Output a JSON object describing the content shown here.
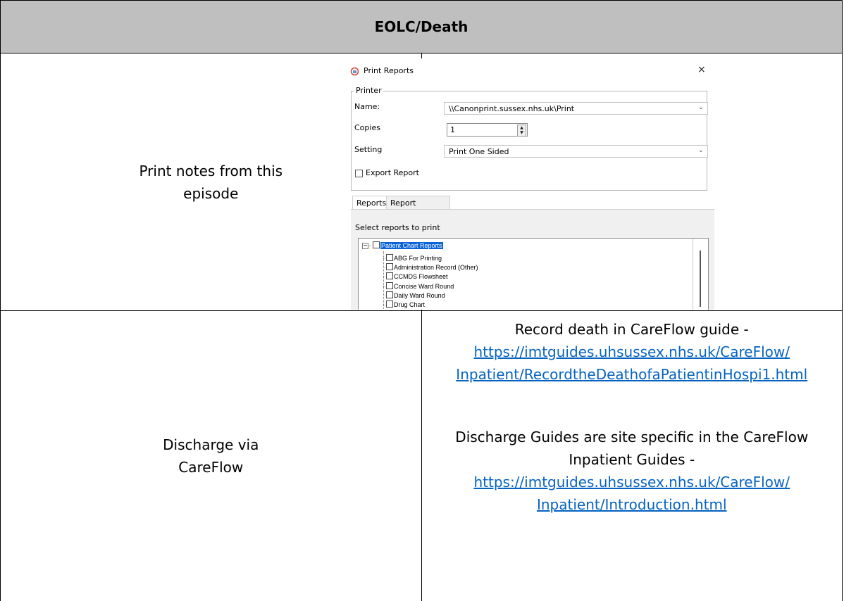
{
  "table": {
    "header": "EOLC/Death",
    "row1_label": "Print notes from this episode",
    "row2_label": "Discharge via CareFlow"
  },
  "row2": {
    "death_intro": "Record death in CareFlow guide -",
    "death_link_line1": "https://imtguides.uhsussex.nhs.uk/CareFlow/",
    "death_link_line2": "Inpatient/RecordtheDeathofaPatientinHospi1.html",
    "discharge_intro": "Discharge Guides are site specific in the CareFlow Inpatient Guides -",
    "discharge_link_line1": "https://imtguides.uhsussex.nhs.uk/CareFlow/",
    "discharge_link_line2": "Inpatient/Introduction.html",
    "link_color": "#0563c1"
  },
  "dialog": {
    "title": "Print Reports",
    "close_glyph": "×",
    "printer_group_label": "Printer",
    "name_label": "Name:",
    "name_value": "\\\\Canonprint.sussex.nhs.uk\\Print",
    "copies_label": "Copies",
    "copies_value": "1",
    "setting_label": "Setting",
    "setting_value": "Print One Sided",
    "export_label": "Export Report",
    "tabs": [
      "Reports",
      "Report packets"
    ],
    "select_label": "Select reports to print",
    "tree_root": "Patient Chart Reports",
    "tree_items": [
      "ABG For Printing",
      "Administration Record (Other)",
      "CCMDS Flowsheet",
      "Concise Ward Round",
      "Daily Ward Round",
      "Drug Chart"
    ],
    "selection_color": "#0a64d8"
  }
}
